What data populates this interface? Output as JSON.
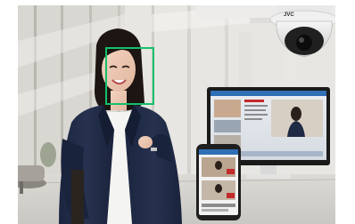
{
  "scene": {
    "description_label": "",
    "camera": {
      "brand_text": "JVC"
    },
    "colors": {
      "face_box": "#13c06a",
      "blazer": "#1f2a44",
      "shirt": "#f4f4f2",
      "hair": "#1c1512",
      "monitor_bezel": "#1a1a1a",
      "phone_body": "#1e1e1e",
      "ui_accent_red": "#c42a2a",
      "ui_accent_blue": "#2f6fb5"
    }
  }
}
